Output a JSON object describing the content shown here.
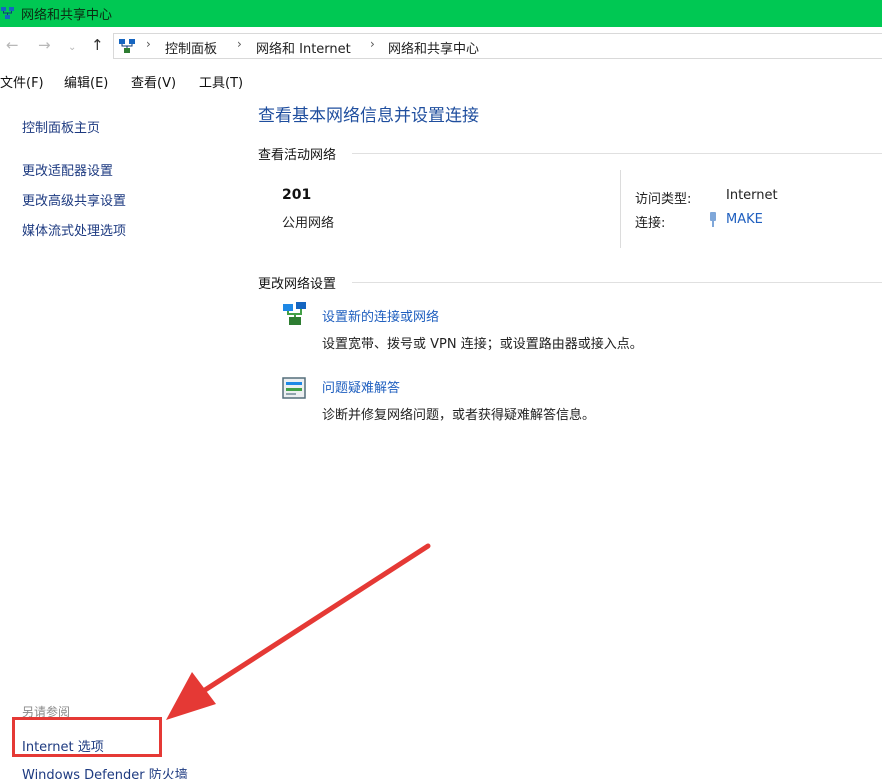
{
  "window": {
    "title": "网络和共享中心"
  },
  "address": {
    "breadcrumbs": [
      "控制面板",
      "网络和 Internet",
      "网络和共享中心"
    ]
  },
  "menu": {
    "items": [
      "文件(F)",
      "编辑(E)",
      "查看(V)",
      "工具(T)"
    ]
  },
  "sidebar": {
    "home": "控制面板主页",
    "links": [
      "更改适配器设置",
      "更改高级共享设置",
      "媒体流式处理选项"
    ],
    "see_also_label": "另请参阅",
    "see_also_links": [
      "Internet 选项",
      "Windows Defender 防火墙"
    ]
  },
  "main": {
    "title": "查看基本网络信息并设置连接",
    "active_networks_heading": "查看活动网络",
    "network": {
      "name": "201",
      "type": "公用网络",
      "access_type_label": "访问类型:",
      "access_type_value": "Internet",
      "connection_label": "连接:",
      "connection_value": "MAKE"
    },
    "change_settings_heading": "更改网络设置",
    "tasks": [
      {
        "title": "设置新的连接或网络",
        "desc": "设置宽带、拨号或 VPN 连接；或设置路由器或接入点。",
        "icon": "network-setup-icon"
      },
      {
        "title": "问题疑难解答",
        "desc": "诊断并修复网络问题，或者获得疑难解答信息。",
        "icon": "troubleshoot-icon"
      }
    ]
  },
  "annotation": {
    "color": "#e53935"
  },
  "colors": {
    "titlebar": "#00c853",
    "link": "#1f5fbf",
    "title": "#1f4e9e"
  }
}
